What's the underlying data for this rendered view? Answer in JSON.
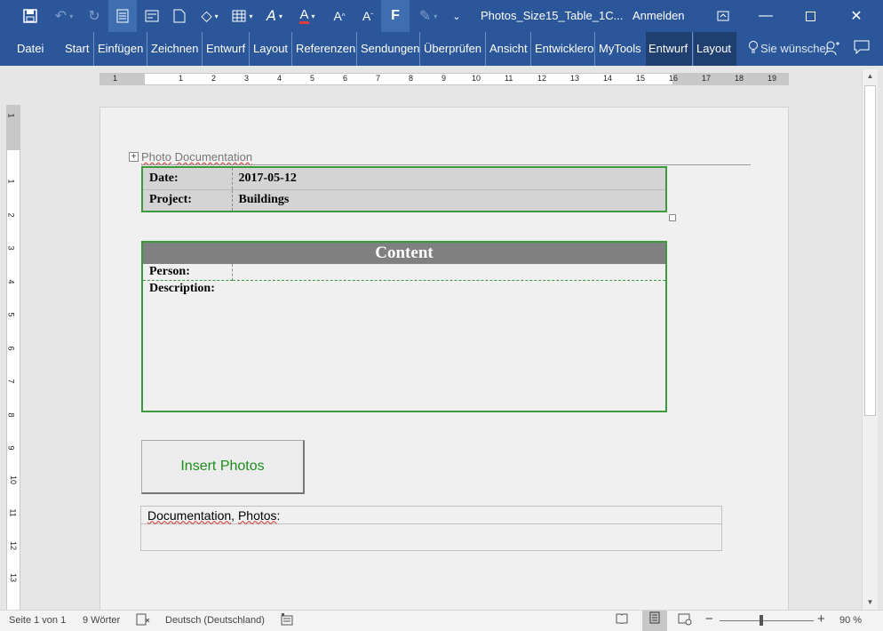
{
  "titlebar": {
    "document_title": "Photos_Size15_Table_1C...",
    "signin_label": "Anmelden",
    "format_button_label": "F",
    "background_color": "#2b579a"
  },
  "ribbon": {
    "tabs": [
      "Datei",
      "Start",
      "Einfügen",
      "Zeichnen",
      "Entwurf",
      "Layout",
      "Referenzen",
      "Sendungen",
      "Überprüfen",
      "Ansicht",
      "Entwickleroo",
      "MyTools",
      "Entwurf",
      "Layout"
    ],
    "tell_me": "Sie wünschen",
    "contextual_tab_color": "#1f3f70"
  },
  "ruler": {
    "tab_selector": "L",
    "h_ticks": [
      "1",
      "1",
      "2",
      "3",
      "4",
      "5",
      "6",
      "7",
      "8",
      "9",
      "10",
      "11",
      "12",
      "13",
      "14",
      "15",
      "16",
      "17",
      "18",
      "19"
    ],
    "v_ticks": [
      "1",
      "1",
      "2",
      "3",
      "4",
      "5",
      "6",
      "7",
      "8",
      "9",
      "10",
      "11",
      "12",
      "13"
    ]
  },
  "document": {
    "heading_word1": "Photo",
    "heading_word2": "Documentation",
    "info_table": {
      "date_label": "Date:",
      "date_value": "2017-05-12",
      "project_label": "Project:",
      "project_value": "Buildings"
    },
    "content_table": {
      "header": "Content",
      "person_label": "Person:",
      "person_value": "",
      "description_label": "Description:"
    },
    "insert_button_label": "Insert Photos",
    "photo_table": {
      "label_part1": "Documentation",
      "label_part2": ", ",
      "label_part3": "Photos",
      "label_part4": ":"
    },
    "accent_color": "#3b9a3b"
  },
  "statusbar": {
    "page_info": "Seite 1 von 1",
    "word_count": "9 Wörter",
    "language": "Deutsch (Deutschland)",
    "zoom_level": "90 %",
    "zoom_percent": 90
  }
}
